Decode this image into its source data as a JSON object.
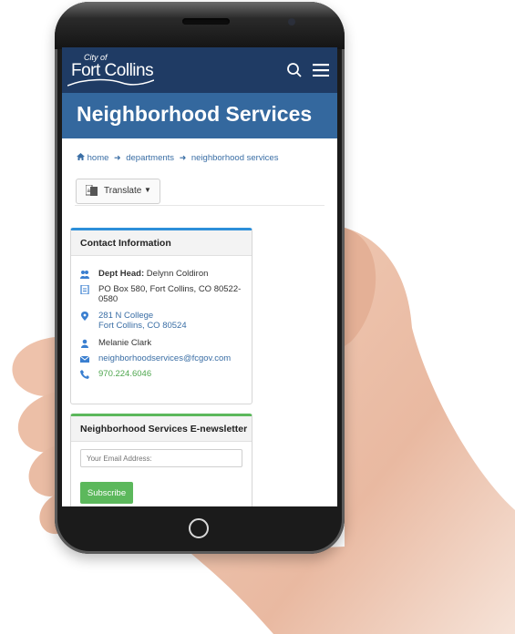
{
  "header": {
    "logo_city_of": "City of",
    "logo_name": "Fort Collins"
  },
  "page": {
    "title": "Neighborhood Services"
  },
  "breadcrumb": {
    "home": "home",
    "departments": "departments",
    "current": "neighborhood services"
  },
  "translate": {
    "label": "Translate",
    "caret": "▼"
  },
  "contact": {
    "heading": "Contact Information",
    "dept_head_label": "Dept Head:",
    "dept_head_name": "Delynn Coldiron",
    "po_box": "PO Box 580, Fort Collins, CO 80522-0580",
    "address_line1": "281 N College",
    "address_line2": "Fort Collins, CO 80524",
    "contact_person": "Melanie Clark",
    "email": "neighborhoodservices@fcgov.com",
    "phone": "970.224.6046"
  },
  "newsletter": {
    "heading": "Neighborhood Services E-newsletter",
    "email_placeholder": "Your Email Address:",
    "subscribe_label": "Subscribe"
  },
  "colors": {
    "topbar": "#1f3b64",
    "banner": "#34689e",
    "link": "#3a6ea5",
    "contact_accent": "#2d8fd9",
    "newsletter_accent": "#5cb85c"
  }
}
